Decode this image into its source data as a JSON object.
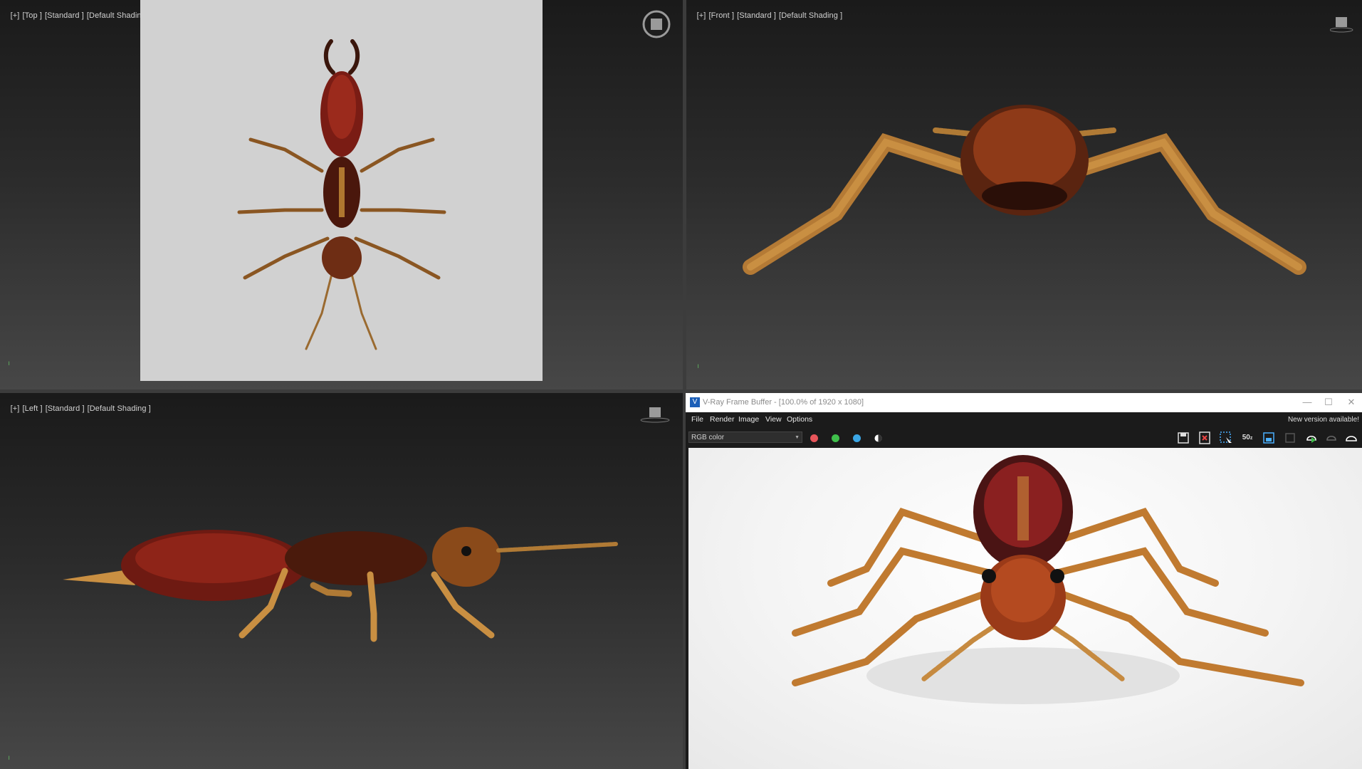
{
  "viewports": {
    "top": {
      "labels": [
        "[+]",
        "[Top ]",
        "[Standard ]",
        "[Default Shading ]"
      ]
    },
    "front": {
      "labels": [
        "[+]",
        "[Front ]",
        "[Standard ]",
        "[Default Shading ]"
      ]
    },
    "left": {
      "labels": [
        "[+]",
        "[Left ]",
        "[Standard ]",
        "[Default Shading ]"
      ]
    }
  },
  "vfb": {
    "title": "V-Ray Frame Buffer - [100.0% of 1920 x 1080]",
    "logo": "V",
    "window_buttons": [
      "—",
      "☐",
      "✕"
    ],
    "menu": [
      "File",
      "Render",
      "Image",
      "View",
      "Options"
    ],
    "new_version": "New version available!",
    "channel": "RGB color",
    "channel_dots": [
      {
        "name": "red-channel-toggle",
        "color": "#e8555a"
      },
      {
        "name": "green-channel-toggle",
        "color": "#3fbf4b"
      },
      {
        "name": "blue-channel-toggle",
        "color": "#3ba7e6"
      }
    ],
    "toolbar_text_50": "50"
  },
  "colors": {
    "viewport_gray": "#cfcfcf",
    "body_dark": "#5a1410",
    "body_red": "#8e2418",
    "leg": "#b47a35",
    "leg_light": "#c98f42"
  }
}
